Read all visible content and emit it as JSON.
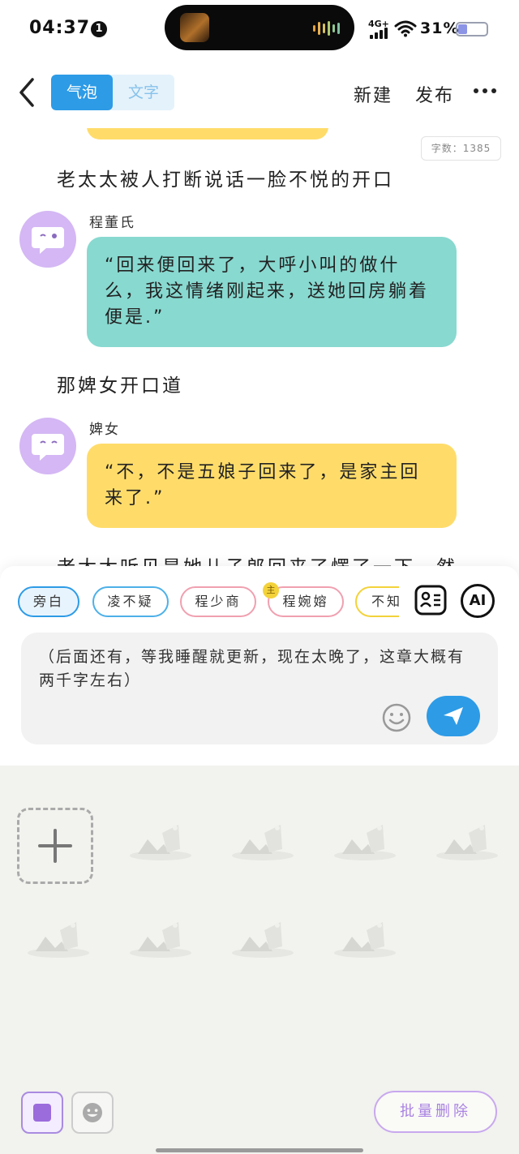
{
  "status_bar": {
    "time": "04:37",
    "notification_count": "1",
    "network": "4G+",
    "battery_percent": "31%",
    "battery_level": 0.31,
    "icons": [
      "signal-icon",
      "wifi-icon",
      "battery-icon",
      "audio-wave-icon"
    ]
  },
  "nav": {
    "back_icon": "chevron-left-icon",
    "tabs": [
      {
        "label": "气泡",
        "active": true
      },
      {
        "label": "文字",
        "active": false
      }
    ],
    "new_label": "新建",
    "publish_label": "发布",
    "more_icon": "more-dots-icon"
  },
  "chat": {
    "word_count": "字数：1385",
    "narration_1": "老太太被人打断说话一脸不悦的开口",
    "message_1": {
      "speaker": "程董氏",
      "text": "“回来便回来了，大呼小叫的做什么，我这情绪刚起来，送她回房躺着便是.”",
      "color": "#88d9d0"
    },
    "narration_2": "那婢女开口道",
    "message_2": {
      "speaker": "婢女",
      "text": "“不，不是五娘子回来了，是家主回来了.”",
      "color": "#ffdc6a"
    },
    "narration_3": "老太太听见是她儿子郎回来了愣了一下，然"
  },
  "composer": {
    "characters": [
      {
        "label": "旁白",
        "selected": true
      },
      {
        "label": "凌不疑",
        "selected": false
      },
      {
        "label": "程少商",
        "selected": false
      },
      {
        "label": "程婉嫆",
        "selected": false,
        "badge": "主"
      },
      {
        "label": "不知",
        "selected": false
      }
    ],
    "roles_icon": "character-card-icon",
    "ai_label": "AI",
    "input_text": "（后面还有，等我睡醒就更新，现在太晚了，这章大概有两千字左右）",
    "emoji_icon": "smiley-icon",
    "send_icon": "send-plane-icon"
  },
  "panel": {
    "add_icon": "plus-icon",
    "sticker_count": 8,
    "image_tab_icon": "image-icon",
    "emoji_tab_icon": "emoji-face-icon",
    "batch_delete_label": "批量删除"
  },
  "colors": {
    "accent": "#2d9be6",
    "avatar": "#d4b7f4",
    "bubble_teal": "#88d9d0",
    "bubble_yellow": "#ffdc6a",
    "purple": "#a982e2"
  }
}
